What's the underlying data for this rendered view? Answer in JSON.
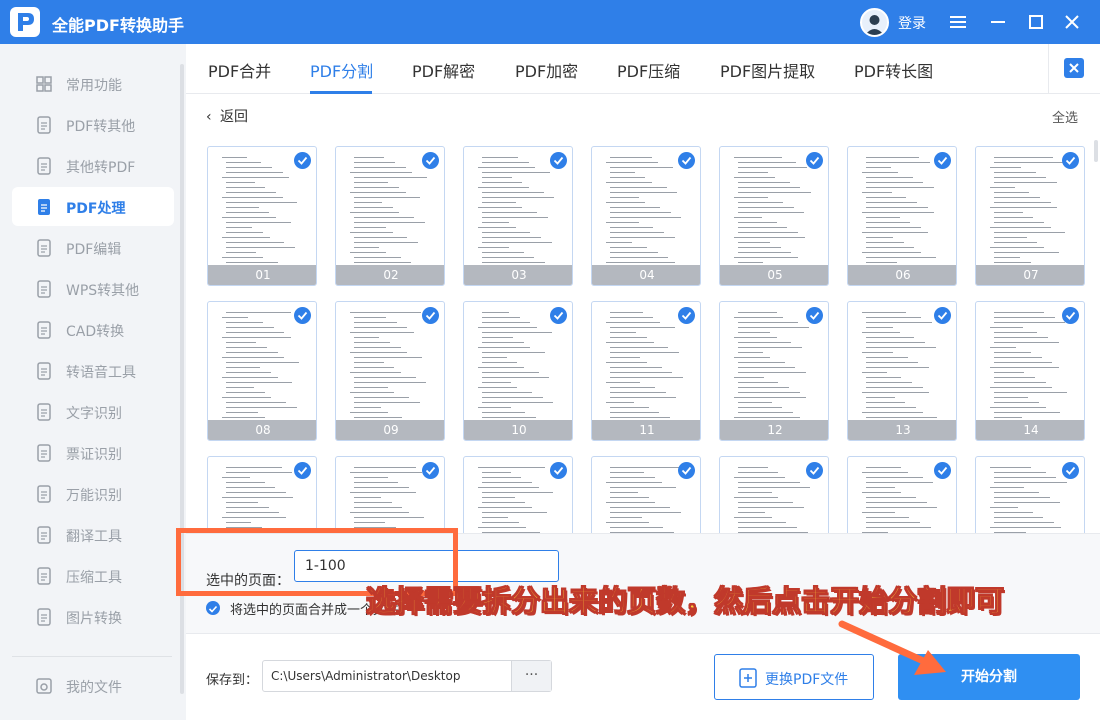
{
  "app": {
    "title": "全能PDF转换助手",
    "login": "登录"
  },
  "sidebar": {
    "items": [
      {
        "label": "常用功能",
        "icon": "grid-icon"
      },
      {
        "label": "PDF转其他",
        "icon": "pdf-export-icon"
      },
      {
        "label": "其他转PDF",
        "icon": "pdf-import-icon"
      },
      {
        "label": "PDF处理",
        "icon": "pdf-process-icon",
        "active": true
      },
      {
        "label": "PDF编辑",
        "icon": "pdf-edit-icon"
      },
      {
        "label": "WPS转其他",
        "icon": "wps-icon"
      },
      {
        "label": "CAD转换",
        "icon": "cad-icon"
      },
      {
        "label": "转语音工具",
        "icon": "voice-icon"
      },
      {
        "label": "文字识别",
        "icon": "ocr-icon"
      },
      {
        "label": "票证识别",
        "icon": "ticket-icon"
      },
      {
        "label": "万能识别",
        "icon": "eye-icon"
      },
      {
        "label": "翻译工具",
        "icon": "translate-icon"
      },
      {
        "label": "压缩工具",
        "icon": "zip-icon"
      },
      {
        "label": "图片转换",
        "icon": "image-icon"
      }
    ],
    "my_files": "我的文件"
  },
  "tabs": [
    "PDF合并",
    "PDF分割",
    "PDF解密",
    "PDF加密",
    "PDF压缩",
    "PDF图片提取",
    "PDF转长图"
  ],
  "active_tab": "PDF分割",
  "toolbar": {
    "back": "返回",
    "select_all": "全选"
  },
  "pages": [
    "01",
    "02",
    "03",
    "04",
    "05",
    "06",
    "07",
    "08",
    "09",
    "10",
    "11",
    "12",
    "13",
    "14",
    "",
    "",
    "",
    "",
    "",
    "",
    ""
  ],
  "selection": {
    "label": "选中的页面：",
    "value": "1-100",
    "merge_label": "将选中的页面合并成一个文件"
  },
  "annotation": "选择需要拆分出来的页数，然后点击开始分割即可",
  "save": {
    "label": "保存到：",
    "path": "C:\\Users\\Administrator\\Desktop",
    "more": "···"
  },
  "buttons": {
    "change_file": "更换PDF文件",
    "start": "开始分割"
  },
  "colors": {
    "primary": "#2f7fe8",
    "annotation_text": "#ffd43b",
    "annotation_box": "#ff6b3d"
  }
}
